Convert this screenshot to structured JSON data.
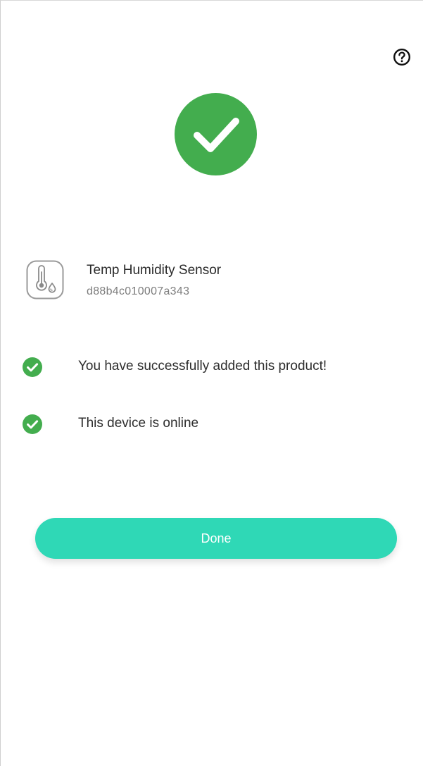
{
  "header": {
    "help_icon": "question-circle-icon"
  },
  "success": {
    "icon": "check-circle-icon",
    "color": "#43ad4e"
  },
  "device": {
    "icon": "thermometer-droplet-icon",
    "name": "Temp Humidity Sensor",
    "id": "d88b4c010007a343"
  },
  "status": {
    "check_color": "#43ad4e",
    "items": [
      {
        "icon": "check-circle-icon",
        "text": "You have successfully added this product!"
      },
      {
        "icon": "check-circle-icon",
        "text": "This device is online"
      }
    ]
  },
  "actions": {
    "done_label": "Done",
    "done_color": "#2fd8b6"
  }
}
